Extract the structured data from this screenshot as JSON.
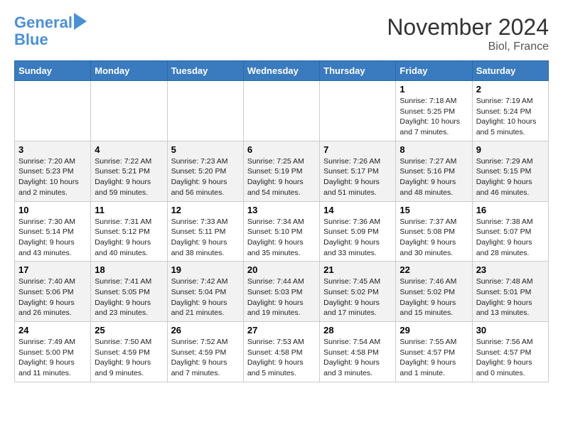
{
  "header": {
    "logo_line1": "General",
    "logo_line2": "Blue",
    "month": "November 2024",
    "location": "Biol, France"
  },
  "weekdays": [
    "Sunday",
    "Monday",
    "Tuesday",
    "Wednesday",
    "Thursday",
    "Friday",
    "Saturday"
  ],
  "weeks": [
    [
      {
        "day": "",
        "info": ""
      },
      {
        "day": "",
        "info": ""
      },
      {
        "day": "",
        "info": ""
      },
      {
        "day": "",
        "info": ""
      },
      {
        "day": "",
        "info": ""
      },
      {
        "day": "1",
        "info": "Sunrise: 7:18 AM\nSunset: 5:25 PM\nDaylight: 10 hours and 7 minutes."
      },
      {
        "day": "2",
        "info": "Sunrise: 7:19 AM\nSunset: 5:24 PM\nDaylight: 10 hours and 5 minutes."
      }
    ],
    [
      {
        "day": "3",
        "info": "Sunrise: 7:20 AM\nSunset: 5:23 PM\nDaylight: 10 hours and 2 minutes."
      },
      {
        "day": "4",
        "info": "Sunrise: 7:22 AM\nSunset: 5:21 PM\nDaylight: 9 hours and 59 minutes."
      },
      {
        "day": "5",
        "info": "Sunrise: 7:23 AM\nSunset: 5:20 PM\nDaylight: 9 hours and 56 minutes."
      },
      {
        "day": "6",
        "info": "Sunrise: 7:25 AM\nSunset: 5:19 PM\nDaylight: 9 hours and 54 minutes."
      },
      {
        "day": "7",
        "info": "Sunrise: 7:26 AM\nSunset: 5:17 PM\nDaylight: 9 hours and 51 minutes."
      },
      {
        "day": "8",
        "info": "Sunrise: 7:27 AM\nSunset: 5:16 PM\nDaylight: 9 hours and 48 minutes."
      },
      {
        "day": "9",
        "info": "Sunrise: 7:29 AM\nSunset: 5:15 PM\nDaylight: 9 hours and 46 minutes."
      }
    ],
    [
      {
        "day": "10",
        "info": "Sunrise: 7:30 AM\nSunset: 5:14 PM\nDaylight: 9 hours and 43 minutes."
      },
      {
        "day": "11",
        "info": "Sunrise: 7:31 AM\nSunset: 5:12 PM\nDaylight: 9 hours and 40 minutes."
      },
      {
        "day": "12",
        "info": "Sunrise: 7:33 AM\nSunset: 5:11 PM\nDaylight: 9 hours and 38 minutes."
      },
      {
        "day": "13",
        "info": "Sunrise: 7:34 AM\nSunset: 5:10 PM\nDaylight: 9 hours and 35 minutes."
      },
      {
        "day": "14",
        "info": "Sunrise: 7:36 AM\nSunset: 5:09 PM\nDaylight: 9 hours and 33 minutes."
      },
      {
        "day": "15",
        "info": "Sunrise: 7:37 AM\nSunset: 5:08 PM\nDaylight: 9 hours and 30 minutes."
      },
      {
        "day": "16",
        "info": "Sunrise: 7:38 AM\nSunset: 5:07 PM\nDaylight: 9 hours and 28 minutes."
      }
    ],
    [
      {
        "day": "17",
        "info": "Sunrise: 7:40 AM\nSunset: 5:06 PM\nDaylight: 9 hours and 26 minutes."
      },
      {
        "day": "18",
        "info": "Sunrise: 7:41 AM\nSunset: 5:05 PM\nDaylight: 9 hours and 23 minutes."
      },
      {
        "day": "19",
        "info": "Sunrise: 7:42 AM\nSunset: 5:04 PM\nDaylight: 9 hours and 21 minutes."
      },
      {
        "day": "20",
        "info": "Sunrise: 7:44 AM\nSunset: 5:03 PM\nDaylight: 9 hours and 19 minutes."
      },
      {
        "day": "21",
        "info": "Sunrise: 7:45 AM\nSunset: 5:02 PM\nDaylight: 9 hours and 17 minutes."
      },
      {
        "day": "22",
        "info": "Sunrise: 7:46 AM\nSunset: 5:02 PM\nDaylight: 9 hours and 15 minutes."
      },
      {
        "day": "23",
        "info": "Sunrise: 7:48 AM\nSunset: 5:01 PM\nDaylight: 9 hours and 13 minutes."
      }
    ],
    [
      {
        "day": "24",
        "info": "Sunrise: 7:49 AM\nSunset: 5:00 PM\nDaylight: 9 hours and 11 minutes."
      },
      {
        "day": "25",
        "info": "Sunrise: 7:50 AM\nSunset: 4:59 PM\nDaylight: 9 hours and 9 minutes."
      },
      {
        "day": "26",
        "info": "Sunrise: 7:52 AM\nSunset: 4:59 PM\nDaylight: 9 hours and 7 minutes."
      },
      {
        "day": "27",
        "info": "Sunrise: 7:53 AM\nSunset: 4:58 PM\nDaylight: 9 hours and 5 minutes."
      },
      {
        "day": "28",
        "info": "Sunrise: 7:54 AM\nSunset: 4:58 PM\nDaylight: 9 hours and 3 minutes."
      },
      {
        "day": "29",
        "info": "Sunrise: 7:55 AM\nSunset: 4:57 PM\nDaylight: 9 hours and 1 minute."
      },
      {
        "day": "30",
        "info": "Sunrise: 7:56 AM\nSunset: 4:57 PM\nDaylight: 9 hours and 0 minutes."
      }
    ]
  ]
}
